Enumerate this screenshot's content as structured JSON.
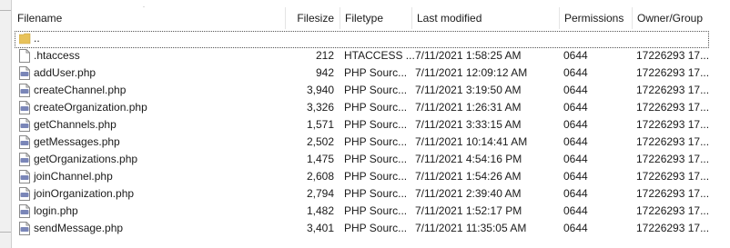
{
  "columns": {
    "filename": "Filename",
    "filesize": "Filesize",
    "filetype": "Filetype",
    "last_modified": "Last modified",
    "permissions": "Permissions",
    "owner_group": "Owner/Group"
  },
  "parent_row": {
    "name": ".."
  },
  "files": [
    {
      "name": ".htaccess",
      "size": "212",
      "type": "HTACCESS ...",
      "modified": "7/11/2021 1:58:25 AM",
      "perm": "0644",
      "owner": "17226293 17...",
      "icon": "blank-file-icon"
    },
    {
      "name": "addUser.php",
      "size": "942",
      "type": "PHP Sourc...",
      "modified": "7/11/2021 12:09:12 AM",
      "perm": "0644",
      "owner": "17226293 17...",
      "icon": "php-file-icon"
    },
    {
      "name": "createChannel.php",
      "size": "3,940",
      "type": "PHP Sourc...",
      "modified": "7/11/2021 3:19:50 AM",
      "perm": "0644",
      "owner": "17226293 17...",
      "icon": "php-file-icon"
    },
    {
      "name": "createOrganization.php",
      "size": "3,326",
      "type": "PHP Sourc...",
      "modified": "7/11/2021 1:26:31 AM",
      "perm": "0644",
      "owner": "17226293 17...",
      "icon": "php-file-icon"
    },
    {
      "name": "getChannels.php",
      "size": "1,571",
      "type": "PHP Sourc...",
      "modified": "7/11/2021 3:33:15 AM",
      "perm": "0644",
      "owner": "17226293 17...",
      "icon": "php-file-icon"
    },
    {
      "name": "getMessages.php",
      "size": "2,502",
      "type": "PHP Sourc...",
      "modified": "7/11/2021 10:14:41 AM",
      "perm": "0644",
      "owner": "17226293 17...",
      "icon": "php-file-icon"
    },
    {
      "name": "getOrganizations.php",
      "size": "1,475",
      "type": "PHP Sourc...",
      "modified": "7/11/2021 4:54:16 PM",
      "perm": "0644",
      "owner": "17226293 17...",
      "icon": "php-file-icon"
    },
    {
      "name": "joinChannel.php",
      "size": "2,608",
      "type": "PHP Sourc...",
      "modified": "7/11/2021 1:54:26 AM",
      "perm": "0644",
      "owner": "17226293 17...",
      "icon": "php-file-icon"
    },
    {
      "name": "joinOrganization.php",
      "size": "2,794",
      "type": "PHP Sourc...",
      "modified": "7/11/2021 2:39:40 AM",
      "perm": "0644",
      "owner": "17226293 17...",
      "icon": "php-file-icon"
    },
    {
      "name": "login.php",
      "size": "1,482",
      "type": "PHP Sourc...",
      "modified": "7/11/2021 1:52:17 PM",
      "perm": "0644",
      "owner": "17226293 17...",
      "icon": "php-file-icon"
    },
    {
      "name": "sendMessage.php",
      "size": "3,401",
      "type": "PHP Sourc...",
      "modified": "7/11/2021 11:35:05 AM",
      "perm": "0644",
      "owner": "17226293 17...",
      "icon": "php-file-icon"
    }
  ],
  "colors": {
    "folder": "#e8c25a",
    "php_icon": "#7a86b8",
    "grid_line": "#e5e5e5"
  }
}
